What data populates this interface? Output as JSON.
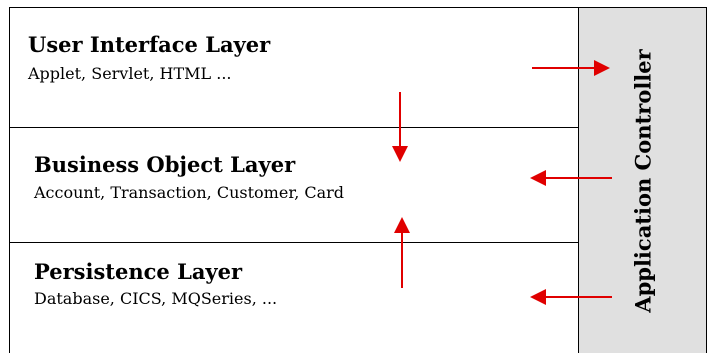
{
  "layers": [
    {
      "title": "User Interface Layer",
      "subtitle": "Applet, Servlet, HTML ..."
    },
    {
      "title": "Business Object Layer",
      "subtitle": "Account, Transaction, Customer, Card"
    },
    {
      "title": "Persistence Layer",
      "subtitle": "Database, CICS, MQSeries, ..."
    }
  ],
  "controller": {
    "label": "Application Controller"
  },
  "colors": {
    "arrow": "#e00000",
    "controller_bg": "#e0e0e0",
    "border": "#000000"
  }
}
